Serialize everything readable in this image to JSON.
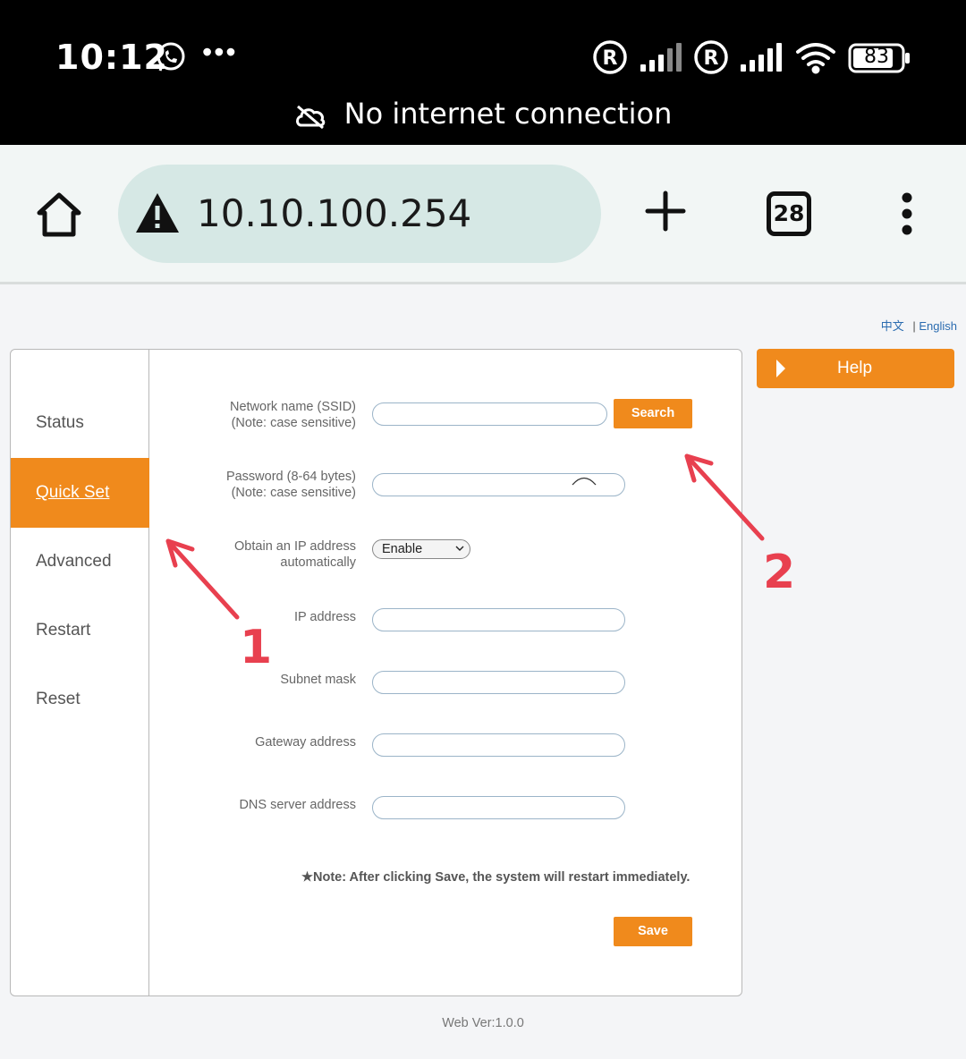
{
  "status_bar": {
    "time": "10:12",
    "overflow_dots": "•••",
    "battery": "83",
    "network_message": "No internet connection",
    "icons": [
      "whatsapp-icon",
      "roaming-icon",
      "signal-icon",
      "roaming-icon",
      "signal-icon",
      "wifi-icon",
      "battery-icon"
    ]
  },
  "browser": {
    "url": "10.10.100.254",
    "tab_count": "28",
    "icons": [
      "home-icon",
      "warning-icon",
      "plus-icon",
      "tabs-icon",
      "menu-icon"
    ]
  },
  "language": {
    "chinese": "中文",
    "separator": "|",
    "english": "English"
  },
  "sidebar": {
    "items": [
      {
        "label": "Status",
        "active": false
      },
      {
        "label": "Quick Set",
        "active": true
      },
      {
        "label": "Advanced",
        "active": false
      },
      {
        "label": "Restart",
        "active": false
      },
      {
        "label": "Reset",
        "active": false
      }
    ]
  },
  "form": {
    "ssid_label_1": "Network name (SSID)",
    "ssid_label_2": "(Note: case sensitive)",
    "ssid_value": "",
    "search_label": "Search",
    "password_label_1": "Password (8-64 bytes)",
    "password_label_2": "(Note: case sensitive)",
    "password_value": "",
    "obtain_ip_label_1": "Obtain an IP address",
    "obtain_ip_label_2": "automatically",
    "obtain_ip_selected": "Enable",
    "ip_label": "IP address",
    "ip_value": "",
    "subnet_label": "Subnet mask",
    "subnet_value": "",
    "gateway_label": "Gateway address",
    "gateway_value": "",
    "dns_label": "DNS server address",
    "dns_value": "",
    "note": "★Note: After clicking Save, the system will restart immediately.",
    "save_label": "Save"
  },
  "help": {
    "label": "Help"
  },
  "footer": {
    "version": "Web Ver:1.0.0"
  },
  "annotations": {
    "arrow_1_label": "1",
    "arrow_2_label": "2",
    "color": "#e8404f"
  },
  "colors": {
    "accent": "#f08a1c",
    "url_bar": "#d6e8e5"
  }
}
